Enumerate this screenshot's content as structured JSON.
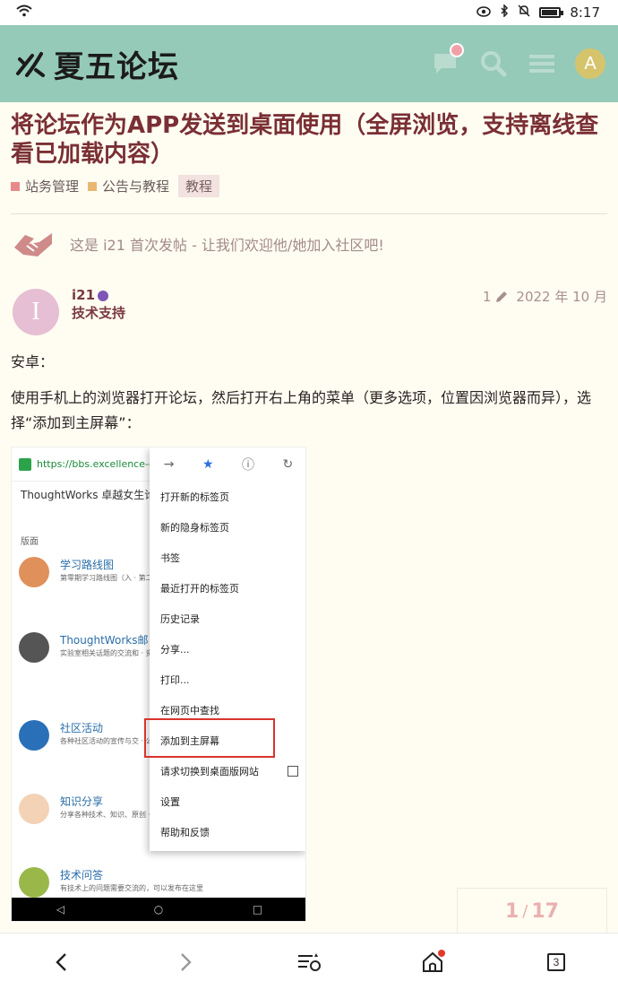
{
  "status": {
    "time": "8:17",
    "battery_level": 0.85
  },
  "header": {
    "site_name": "夏五论坛",
    "user_initial": "A",
    "bg_color": "#95c9b8"
  },
  "topic": {
    "title": "将论坛作为APP发送到桌面使用（全屏浏览，支持离线查看已加载内容）",
    "categories": [
      {
        "label": "站务管理",
        "color": "#e88a8a"
      },
      {
        "label": "公告与教程",
        "color": "#e8b870"
      }
    ],
    "tag": "教程"
  },
  "welcome_text": "这是 i21 首次发帖 - 让我们欢迎他/她加入社区吧!",
  "post": {
    "avatar_letter": "I",
    "username": "i21",
    "user_group": "技术支持",
    "edit_count": "1",
    "date": "2022 年 10 月",
    "paragraph1": "安卓：",
    "paragraph2": "使用手机上的浏览器打开论坛，然后打开右上角的菜单（更多选项，位置因浏览器而异），选择“添加到主屏幕”："
  },
  "screenshot": {
    "url": "https://bbs.excellence-g",
    "site_title": "ThoughtWorks 卓越女生论",
    "section_label": "版面",
    "forums": [
      {
        "title": "学习路线图",
        "desc": "第零期学习路线图（入 · 第二期学习路线图（后端",
        "color": "#e0905a"
      },
      {
        "title": "ThoughtWorks邮",
        "desc": "实验室相关话题的交流和 · 资料区 实验室日 · 代码Review互助 To-D",
        "color": "#555555"
      },
      {
        "title": "社区活动",
        "desc": "各种社区活动的宣传与交 · 公开课",
        "color": "#2a70b8"
      },
      {
        "title": "知识分享",
        "desc": "分享各种技术、知识、原创 · 好用工具分享 好",
        "color": "#f3d2b6"
      },
      {
        "title": "技术问答",
        "desc": "有技术上的问题需要交流的，可以发布在这里",
        "color": "#9ab84a"
      }
    ],
    "menu_items": [
      "打开新的标签页",
      "新的隐身标签页",
      "书签",
      "最近打开的标签页",
      "历史记录",
      "分享...",
      "打印...",
      "在网页中查找",
      "添加到主屏幕",
      "请求切换到桌面版网站",
      "设置",
      "帮助和反馈"
    ]
  },
  "progress": {
    "current": "1",
    "total": "17"
  },
  "bottom": {
    "tab_count": "3"
  }
}
